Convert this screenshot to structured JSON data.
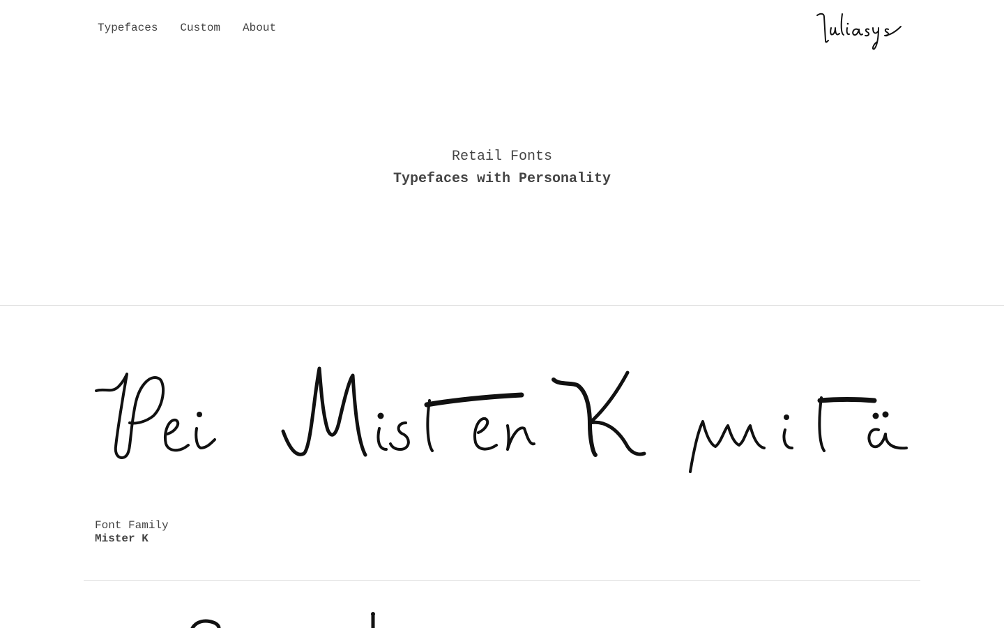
{
  "nav": {
    "items": [
      {
        "label": "Typefaces"
      },
      {
        "label": "Custom"
      },
      {
        "label": "About"
      }
    ]
  },
  "brand": {
    "logo_text": "Juliasys"
  },
  "hero": {
    "subtitle": "Retail Fonts",
    "title": "Typefaces with Personality"
  },
  "fonts": [
    {
      "specimen_text": "Hei Mister K mitä",
      "family_label": "Font Family",
      "family_name": "Mister K"
    }
  ],
  "colors": {
    "text": "#444444",
    "ink": "#111111",
    "divider": "#dcdcdc",
    "background": "#ffffff"
  }
}
